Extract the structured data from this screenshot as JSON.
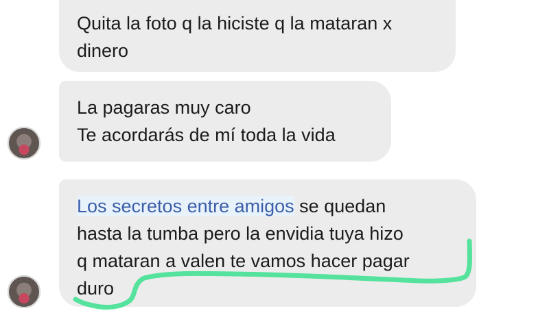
{
  "messages": [
    {
      "lines": [
        "Quita la foto q la hiciste q la mataran x",
        "dinero"
      ]
    },
    {
      "lines": [
        "La pagaras muy caro",
        "Te acordarás de mí toda la vida"
      ]
    },
    {
      "link_text": "Los secretos entre amigos",
      "line1_rest": " se quedan",
      "lines": [
        "hasta la tumba pero la envidia tuya hizo",
        "q mataran a valen te vamos hacer pagar",
        "duro"
      ]
    }
  ],
  "colors": {
    "bubble": "#ececed",
    "link": "#3b5ea8",
    "highlight": "#39e08d"
  }
}
